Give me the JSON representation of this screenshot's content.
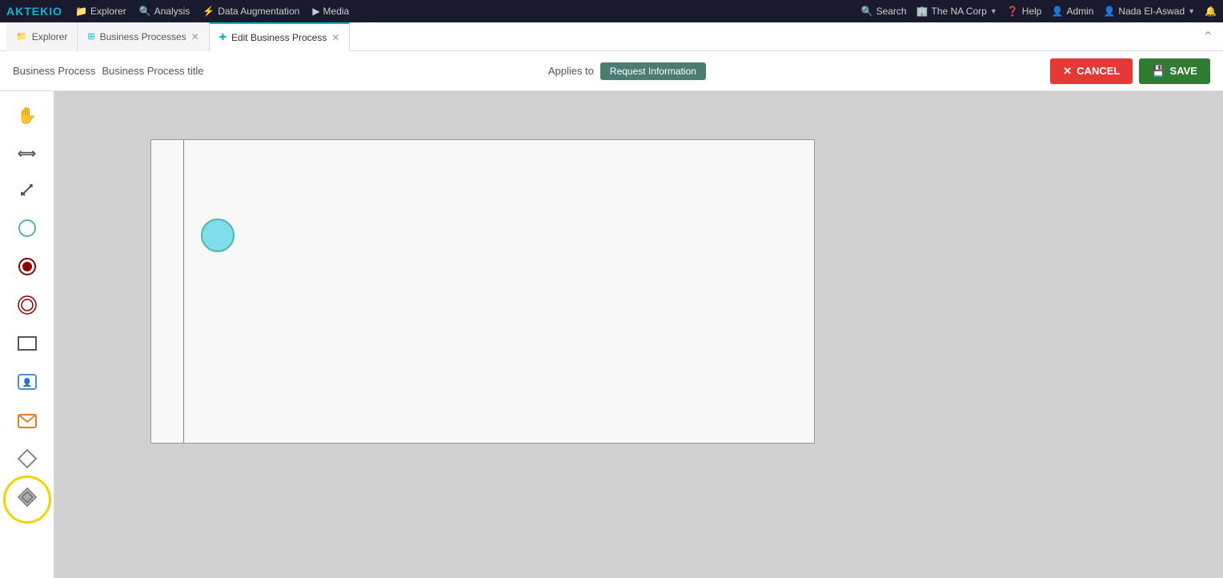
{
  "app": {
    "logo": "AKTEKIO",
    "nav_items": [
      {
        "label": "Explorer",
        "icon": "folder-icon"
      },
      {
        "label": "Analysis",
        "icon": "search-icon"
      },
      {
        "label": "Data Augmentation",
        "icon": "data-icon"
      },
      {
        "label": "Media",
        "icon": "media-icon"
      }
    ],
    "nav_right": [
      {
        "label": "Search",
        "icon": "search-icon"
      },
      {
        "label": "The NA Corp",
        "icon": "building-icon",
        "has_chevron": true
      },
      {
        "label": "Help",
        "icon": "help-icon"
      },
      {
        "label": "Admin",
        "icon": "admin-icon"
      },
      {
        "label": "Nada El-Aswad",
        "icon": "user-icon",
        "has_chevron": true
      }
    ]
  },
  "tabs": [
    {
      "label": "Explorer",
      "icon": "folder-icon",
      "closeable": false,
      "active": false
    },
    {
      "label": "Business Processes",
      "icon": "grid-icon",
      "closeable": true,
      "active": false
    },
    {
      "label": "Edit Business Process",
      "icon": "plus-icon",
      "closeable": true,
      "active": true
    }
  ],
  "toolbar": {
    "breadcrumb": {
      "part1": "Business Process",
      "part2": "Business Process title"
    },
    "applies_to_label": "Applies to",
    "applies_to_btn": "Request Information",
    "cancel_label": "CANCEL",
    "save_label": "SAVE"
  },
  "tools": [
    {
      "id": "hand",
      "label": "Hand tool",
      "icon": "hand"
    },
    {
      "id": "move",
      "label": "Move tool",
      "icon": "move"
    },
    {
      "id": "pen",
      "label": "Pen tool",
      "icon": "pen"
    },
    {
      "id": "circle-outline",
      "label": "Circle outline",
      "icon": "circle-outline"
    },
    {
      "id": "circle-filled",
      "label": "Circle filled",
      "icon": "circle-filled"
    },
    {
      "id": "circle-double",
      "label": "Circle double",
      "icon": "circle-double"
    },
    {
      "id": "rectangle",
      "label": "Rectangle",
      "icon": "rect"
    },
    {
      "id": "task",
      "label": "Task",
      "icon": "task"
    },
    {
      "id": "envelope",
      "label": "Envelope",
      "icon": "envelope"
    },
    {
      "id": "diamond",
      "label": "Diamond",
      "icon": "diamond"
    },
    {
      "id": "diamond2",
      "label": "Diamond filled",
      "icon": "diamond2",
      "highlighted": true
    }
  ],
  "canvas": {
    "circle": {
      "color": "#80deea",
      "border_color": "#4db6ac"
    }
  }
}
